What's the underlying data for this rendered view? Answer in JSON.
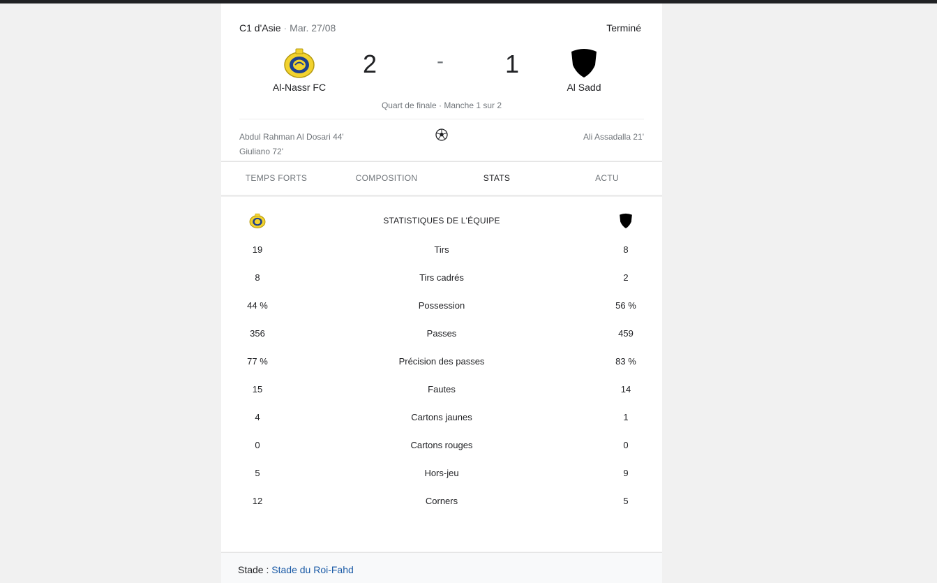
{
  "match": {
    "competition": "C1 d'Asie",
    "separator": "·",
    "date": "Mar. 27/08",
    "status": "Terminé",
    "home": {
      "name": "Al-Nassr FC",
      "score": "2",
      "crest": "al-nassr-crest"
    },
    "away": {
      "name": "Al Sadd",
      "score": "1",
      "crest": "al-sadd-crest"
    },
    "dash": "-",
    "round": "Quart de finale · Manche 1 sur 2",
    "scorers_home": [
      "Abdul Rahman Al Dosari 44'",
      "Giuliano 72'"
    ],
    "scorers_away": [
      "Ali Assadalla 21'"
    ],
    "goal_icon": "soccer-ball-icon"
  },
  "tabs": [
    {
      "label": "TEMPS FORTS",
      "active": false
    },
    {
      "label": "COMPOSITION",
      "active": false
    },
    {
      "label": "STATS",
      "active": true
    },
    {
      "label": "ACTU",
      "active": false
    }
  ],
  "stats": {
    "title": "STATISTIQUES DE L'ÉQUIPE",
    "rows": [
      {
        "label": "Tirs",
        "home": "19",
        "away": "8"
      },
      {
        "label": "Tirs cadrés",
        "home": "8",
        "away": "2"
      },
      {
        "label": "Possession",
        "home": "44 %",
        "away": "56 %"
      },
      {
        "label": "Passes",
        "home": "356",
        "away": "459"
      },
      {
        "label": "Précision des passes",
        "home": "77 %",
        "away": "83 %"
      },
      {
        "label": "Fautes",
        "home": "15",
        "away": "14"
      },
      {
        "label": "Cartons jaunes",
        "home": "4",
        "away": "1"
      },
      {
        "label": "Cartons rouges",
        "home": "0",
        "away": "0"
      },
      {
        "label": "Hors-jeu",
        "home": "5",
        "away": "9"
      },
      {
        "label": "Corners",
        "home": "12",
        "away": "5"
      }
    ]
  },
  "venue": {
    "key": "Stade :",
    "value": "Stade du Roi-Fahd"
  },
  "colors": {
    "link": "#1a5aa6",
    "muted": "#70757a",
    "text": "#202124"
  }
}
